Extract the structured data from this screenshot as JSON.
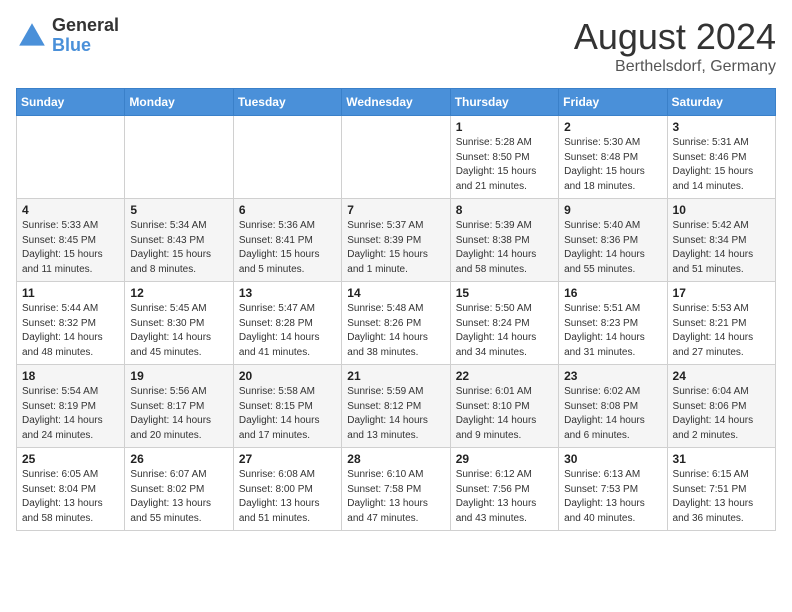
{
  "logo": {
    "general": "General",
    "blue": "Blue"
  },
  "title": "August 2024",
  "location": "Berthelsdorf, Germany",
  "days_of_week": [
    "Sunday",
    "Monday",
    "Tuesday",
    "Wednesday",
    "Thursday",
    "Friday",
    "Saturday"
  ],
  "weeks": [
    [
      {
        "num": "",
        "detail": ""
      },
      {
        "num": "",
        "detail": ""
      },
      {
        "num": "",
        "detail": ""
      },
      {
        "num": "",
        "detail": ""
      },
      {
        "num": "1",
        "detail": "Sunrise: 5:28 AM\nSunset: 8:50 PM\nDaylight: 15 hours\nand 21 minutes."
      },
      {
        "num": "2",
        "detail": "Sunrise: 5:30 AM\nSunset: 8:48 PM\nDaylight: 15 hours\nand 18 minutes."
      },
      {
        "num": "3",
        "detail": "Sunrise: 5:31 AM\nSunset: 8:46 PM\nDaylight: 15 hours\nand 14 minutes."
      }
    ],
    [
      {
        "num": "4",
        "detail": "Sunrise: 5:33 AM\nSunset: 8:45 PM\nDaylight: 15 hours\nand 11 minutes."
      },
      {
        "num": "5",
        "detail": "Sunrise: 5:34 AM\nSunset: 8:43 PM\nDaylight: 15 hours\nand 8 minutes."
      },
      {
        "num": "6",
        "detail": "Sunrise: 5:36 AM\nSunset: 8:41 PM\nDaylight: 15 hours\nand 5 minutes."
      },
      {
        "num": "7",
        "detail": "Sunrise: 5:37 AM\nSunset: 8:39 PM\nDaylight: 15 hours\nand 1 minute."
      },
      {
        "num": "8",
        "detail": "Sunrise: 5:39 AM\nSunset: 8:38 PM\nDaylight: 14 hours\nand 58 minutes."
      },
      {
        "num": "9",
        "detail": "Sunrise: 5:40 AM\nSunset: 8:36 PM\nDaylight: 14 hours\nand 55 minutes."
      },
      {
        "num": "10",
        "detail": "Sunrise: 5:42 AM\nSunset: 8:34 PM\nDaylight: 14 hours\nand 51 minutes."
      }
    ],
    [
      {
        "num": "11",
        "detail": "Sunrise: 5:44 AM\nSunset: 8:32 PM\nDaylight: 14 hours\nand 48 minutes."
      },
      {
        "num": "12",
        "detail": "Sunrise: 5:45 AM\nSunset: 8:30 PM\nDaylight: 14 hours\nand 45 minutes."
      },
      {
        "num": "13",
        "detail": "Sunrise: 5:47 AM\nSunset: 8:28 PM\nDaylight: 14 hours\nand 41 minutes."
      },
      {
        "num": "14",
        "detail": "Sunrise: 5:48 AM\nSunset: 8:26 PM\nDaylight: 14 hours\nand 38 minutes."
      },
      {
        "num": "15",
        "detail": "Sunrise: 5:50 AM\nSunset: 8:24 PM\nDaylight: 14 hours\nand 34 minutes."
      },
      {
        "num": "16",
        "detail": "Sunrise: 5:51 AM\nSunset: 8:23 PM\nDaylight: 14 hours\nand 31 minutes."
      },
      {
        "num": "17",
        "detail": "Sunrise: 5:53 AM\nSunset: 8:21 PM\nDaylight: 14 hours\nand 27 minutes."
      }
    ],
    [
      {
        "num": "18",
        "detail": "Sunrise: 5:54 AM\nSunset: 8:19 PM\nDaylight: 14 hours\nand 24 minutes."
      },
      {
        "num": "19",
        "detail": "Sunrise: 5:56 AM\nSunset: 8:17 PM\nDaylight: 14 hours\nand 20 minutes."
      },
      {
        "num": "20",
        "detail": "Sunrise: 5:58 AM\nSunset: 8:15 PM\nDaylight: 14 hours\nand 17 minutes."
      },
      {
        "num": "21",
        "detail": "Sunrise: 5:59 AM\nSunset: 8:12 PM\nDaylight: 14 hours\nand 13 minutes."
      },
      {
        "num": "22",
        "detail": "Sunrise: 6:01 AM\nSunset: 8:10 PM\nDaylight: 14 hours\nand 9 minutes."
      },
      {
        "num": "23",
        "detail": "Sunrise: 6:02 AM\nSunset: 8:08 PM\nDaylight: 14 hours\nand 6 minutes."
      },
      {
        "num": "24",
        "detail": "Sunrise: 6:04 AM\nSunset: 8:06 PM\nDaylight: 14 hours\nand 2 minutes."
      }
    ],
    [
      {
        "num": "25",
        "detail": "Sunrise: 6:05 AM\nSunset: 8:04 PM\nDaylight: 13 hours\nand 58 minutes."
      },
      {
        "num": "26",
        "detail": "Sunrise: 6:07 AM\nSunset: 8:02 PM\nDaylight: 13 hours\nand 55 minutes."
      },
      {
        "num": "27",
        "detail": "Sunrise: 6:08 AM\nSunset: 8:00 PM\nDaylight: 13 hours\nand 51 minutes."
      },
      {
        "num": "28",
        "detail": "Sunrise: 6:10 AM\nSunset: 7:58 PM\nDaylight: 13 hours\nand 47 minutes."
      },
      {
        "num": "29",
        "detail": "Sunrise: 6:12 AM\nSunset: 7:56 PM\nDaylight: 13 hours\nand 43 minutes."
      },
      {
        "num": "30",
        "detail": "Sunrise: 6:13 AM\nSunset: 7:53 PM\nDaylight: 13 hours\nand 40 minutes."
      },
      {
        "num": "31",
        "detail": "Sunrise: 6:15 AM\nSunset: 7:51 PM\nDaylight: 13 hours\nand 36 minutes."
      }
    ]
  ]
}
